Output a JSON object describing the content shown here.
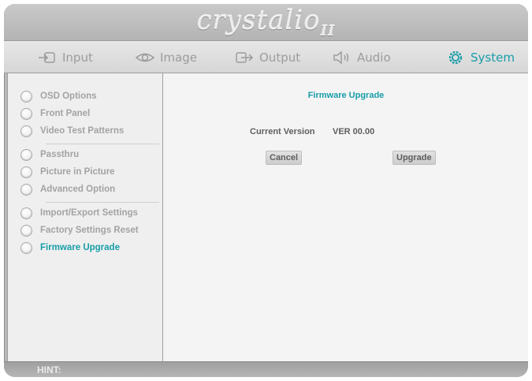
{
  "brand": {
    "logo_text": "crystalio",
    "logo_suffix": "II"
  },
  "tabs": [
    {
      "label": "Input",
      "icon": "input-icon",
      "active": false
    },
    {
      "label": "Image",
      "icon": "eye-icon",
      "active": false
    },
    {
      "label": "Output",
      "icon": "output-icon",
      "active": false
    },
    {
      "label": "Audio",
      "icon": "speaker-icon",
      "active": false
    },
    {
      "label": "System",
      "icon": "gear-icon",
      "active": true
    }
  ],
  "sidebar": {
    "items": [
      {
        "label": "OSD Options"
      },
      {
        "label": "Front Panel"
      },
      {
        "label": "Video Test Patterns"
      },
      {
        "label": "Passthru"
      },
      {
        "label": "Picture in Picture"
      },
      {
        "label": "Advanced Option"
      },
      {
        "label": "Import/Export Settings"
      },
      {
        "label": "Factory Settings Reset"
      },
      {
        "label": "Firmware Upgrade",
        "active": true
      }
    ]
  },
  "main": {
    "title": "Firmware Upgrade",
    "current_version_label": "Current Version",
    "current_version_value": "VER 00.00",
    "cancel_label": "Cancel",
    "upgrade_label": "Upgrade"
  },
  "hint": {
    "label": "HINT:"
  },
  "colors": {
    "accent": "#179da8"
  }
}
